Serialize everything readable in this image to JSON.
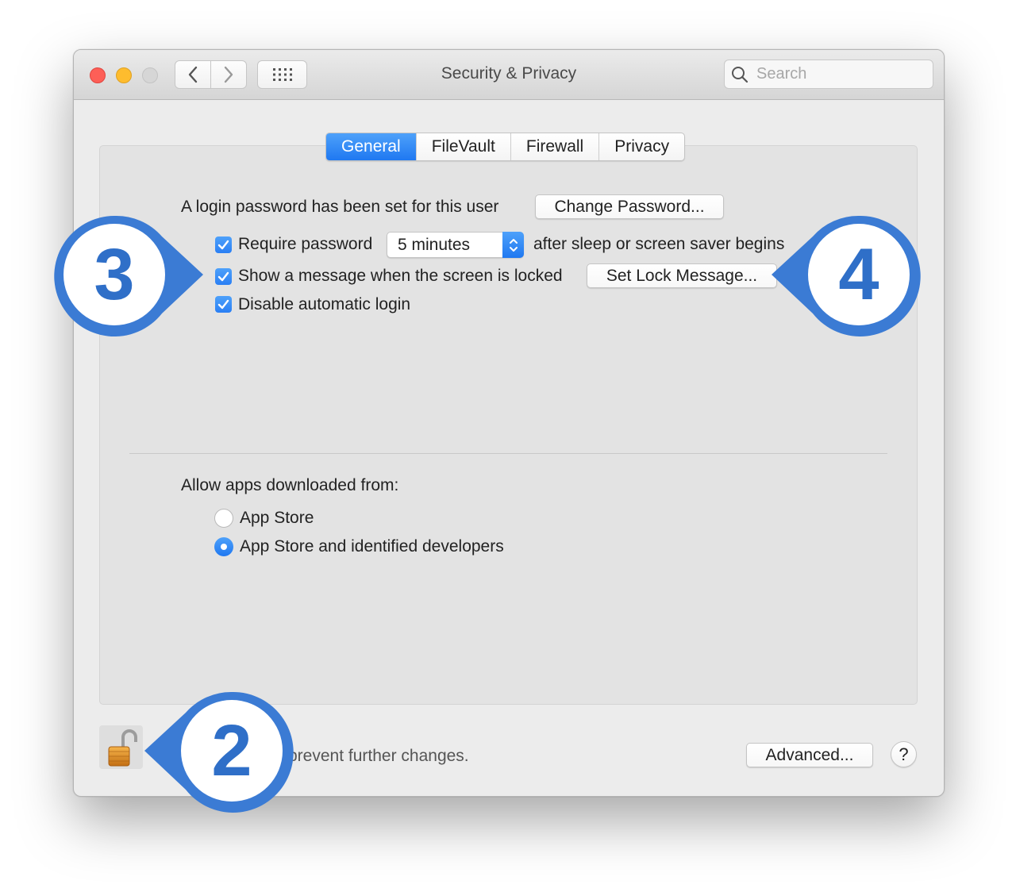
{
  "window": {
    "title": "Security & Privacy"
  },
  "toolbar": {
    "search_placeholder": "Search",
    "back_icon": "chevron-left-icon",
    "forward_icon": "chevron-right-icon",
    "grid_icon": "grid-icon"
  },
  "tabs": [
    {
      "label": "General",
      "active": true
    },
    {
      "label": "FileVault",
      "active": false
    },
    {
      "label": "Firewall",
      "active": false
    },
    {
      "label": "Privacy",
      "active": false
    }
  ],
  "general": {
    "login_password_text": "A login password has been set for this user",
    "change_password_button": "Change Password...",
    "require_password": {
      "label": "Require password",
      "checked": true
    },
    "require_password_interval": "5 minutes",
    "after_sleep_text": "after sleep or screen saver begins",
    "show_message": {
      "label": "Show a message when the screen is locked",
      "checked": true
    },
    "set_lock_message_button": "Set Lock Message...",
    "disable_auto_login": {
      "label": "Disable automatic login",
      "checked": true
    }
  },
  "allow_apps": {
    "heading": "Allow apps downloaded from:",
    "options": [
      {
        "label": "App Store",
        "selected": false
      },
      {
        "label": "App Store and identified developers",
        "selected": true
      }
    ]
  },
  "footer": {
    "lock_text_visible": "prevent further changes.",
    "advanced_button": "Advanced...",
    "help_button": "?"
  },
  "callouts": [
    {
      "number": "3"
    },
    {
      "number": "4"
    },
    {
      "number": "2"
    }
  ],
  "colors": {
    "accent": "#1f78f1",
    "callout_blue": "#3b7bd4",
    "traffic_red": "#fd5f57",
    "traffic_yellow": "#febc2e",
    "traffic_gray": "#d6d6d6"
  }
}
